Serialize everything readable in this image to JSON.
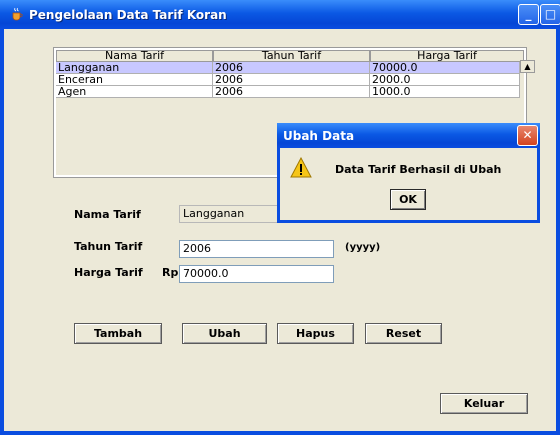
{
  "window": {
    "title": "Pengelolaan Data Tarif Koran",
    "app_icon": "java-cup-icon"
  },
  "table": {
    "columns": [
      "Nama Tarif",
      "Tahun Tarif",
      "Harga Tarif"
    ],
    "rows": [
      [
        "Langganan",
        "2006",
        "70000.0"
      ],
      [
        "Enceran",
        "2006",
        "2000.0"
      ],
      [
        "Agen",
        "2006",
        "1000.0"
      ]
    ],
    "selected_row": 0
  },
  "form": {
    "nama_label": "Nama Tarif",
    "nama_value": "Langganan",
    "tahun_label": "Tahun Tarif",
    "tahun_value": "2006",
    "tahun_hint": "(yyyy)",
    "harga_label": "Harga Tarif",
    "harga_prefix": "Rp",
    "harga_value": "70000.0"
  },
  "buttons": {
    "tambah": "Tambah",
    "ubah": "Ubah",
    "hapus": "Hapus",
    "reset": "Reset",
    "keluar": "Keluar"
  },
  "dialog": {
    "title": "Ubah Data",
    "message": "Data Tarif Berhasil di Ubah",
    "ok": "OK",
    "icon": "warning-icon"
  },
  "colors": {
    "titlebar": "#0a4de0",
    "selection": "#c8c8ff",
    "window_bg": "#ece9d8"
  }
}
